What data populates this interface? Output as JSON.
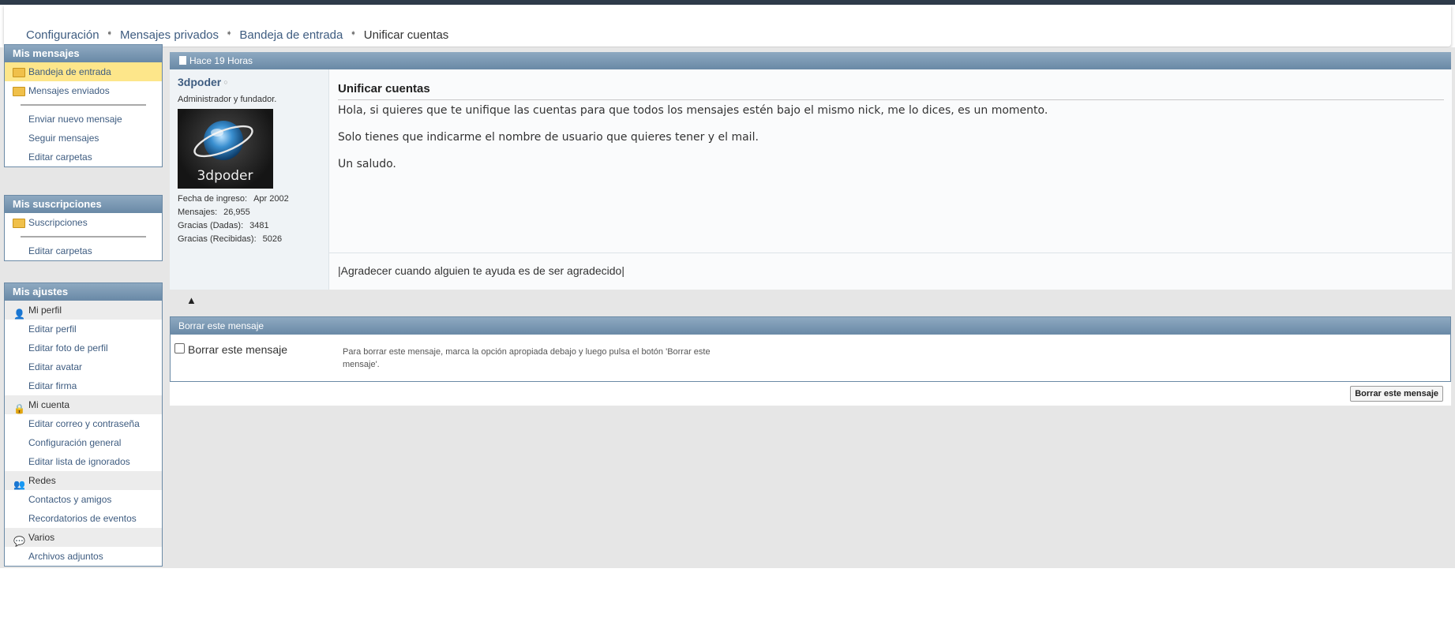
{
  "breadcrumb": {
    "items": [
      "Configuración",
      "Mensajes privados",
      "Bandeja de entrada"
    ],
    "current": "Unificar cuentas"
  },
  "sidebar": {
    "messages": {
      "title": "Mis mensajes",
      "folders": [
        "Bandeja de entrada",
        "Mensajes enviados"
      ],
      "links": [
        "Enviar nuevo mensaje",
        "Seguir mensajes",
        "Editar carpetas"
      ]
    },
    "subscriptions": {
      "title": "Mis suscripciones",
      "folders": [
        "Suscripciones"
      ],
      "links": [
        "Editar carpetas"
      ]
    },
    "settings": {
      "title": "Mis ajustes",
      "sections": [
        {
          "label": "Mi perfil",
          "icon": "user-icon",
          "links": [
            "Editar perfil",
            "Editar foto de perfil",
            "Editar avatar",
            "Editar firma"
          ]
        },
        {
          "label": "Mi cuenta",
          "icon": "lock-icon",
          "links": [
            "Editar correo y contraseña",
            "Configuración general",
            "Editar lista de ignorados"
          ]
        },
        {
          "label": "Redes",
          "icon": "users-icon",
          "links": [
            "Contactos y amigos",
            "Recordatorios de eventos"
          ]
        },
        {
          "label": "Varios",
          "icon": "chat-icon",
          "links": [
            "Archivos adjuntos"
          ]
        }
      ]
    }
  },
  "post": {
    "time": "Hace 19 Horas",
    "username": "3dpoder",
    "user_title": "Administrador y fundador.",
    "avatar_text": "3dpoder",
    "stats": [
      {
        "label": "Fecha de ingreso:",
        "value": "Apr 2002"
      },
      {
        "label": "Mensajes:",
        "value": "26,955"
      },
      {
        "label": "Gracias (Dadas):",
        "value": "3481"
      },
      {
        "label": "Gracias (Recibidas):",
        "value": "5026"
      }
    ],
    "title": "Unificar cuentas",
    "body": [
      "Hola, si quieres que te unifique las cuentas para que todos los mensajes estén bajo el mismo nick, me lo dices, es un momento.",
      "Solo tienes que indicarme el nombre de usuario que quieres tener y el mail.",
      "Un saludo."
    ],
    "signature": "|Agradecer cuando alguien te ayuda es de ser agradecido|"
  },
  "delete": {
    "title": "Borrar este mensaje",
    "checkbox_label": "Borrar este mensaje",
    "description": "Para borrar este mensaje, marca la opción apropiada debajo y luego pulsa el botón 'Borrar este mensaje'.",
    "button": "Borrar este mensaje"
  },
  "colors": {
    "accent": "#6989a6",
    "link": "#3e5c80",
    "selected": "#fde68a"
  }
}
